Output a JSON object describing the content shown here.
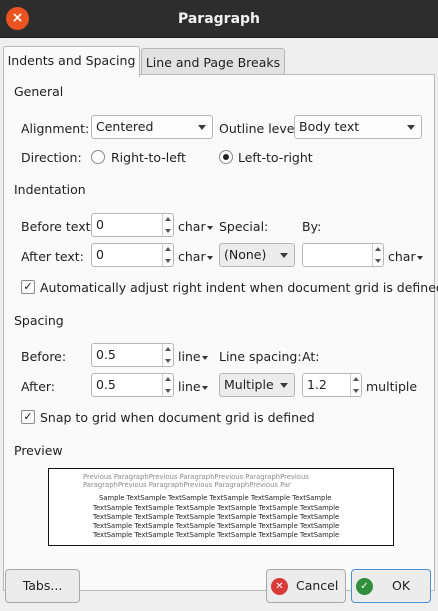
{
  "window": {
    "title": "Paragraph",
    "close_icon": "close-icon"
  },
  "tabs": [
    {
      "label": "Indents and Spacing",
      "active": true
    },
    {
      "label": "Line and Page Breaks",
      "active": false
    }
  ],
  "general": {
    "section_label": "General",
    "alignment_label": "Alignment:",
    "alignment_value": "Centered",
    "outline_label": "Outline level:",
    "outline_value": "Body text",
    "direction_label": "Direction:",
    "rtl_label": "Right-to-left",
    "ltr_label": "Left-to-right",
    "direction_selected": "ltr"
  },
  "indentation": {
    "section_label": "Indentation",
    "before_label": "Before text:",
    "before_value": "0",
    "before_unit": "char",
    "special_label": "Special:",
    "special_value": "(None)",
    "by_label": "By:",
    "by_value": "",
    "by_unit": "char",
    "after_label": "After text:",
    "after_value": "0",
    "after_unit": "char",
    "auto_adjust_label": "Automatically adjust right indent when document grid is defined",
    "auto_adjust_checked": true
  },
  "spacing": {
    "section_label": "Spacing",
    "before_label": "Before:",
    "before_value": "0.5",
    "before_unit": "line",
    "line_spacing_label": "Line spacing:",
    "line_spacing_value": "Multiple",
    "at_label": "At:",
    "at_value": "1.2",
    "at_unit": "multiple",
    "after_label": "After:",
    "after_value": "0.5",
    "after_unit": "line",
    "snap_label": "Snap to grid when document grid is defined",
    "snap_checked": true
  },
  "preview": {
    "section_label": "Preview",
    "prev_line1": "Previous ParagraphPrevious ParagraphPrevious ParagraphPrevious",
    "prev_line2": "ParagraphPrevious ParagraphPrevious ParagraphPrevious Par",
    "sample_line1": "Sample TextSample TextSample TextSample TextSample TextSample",
    "sample_line2": "TextSample TextSample TextSample TextSample TextSample TextSample",
    "sample_line3": "TextSample TextSample TextSample TextSample TextSample TextSample",
    "sample_line4": "TextSample TextSample TextSample TextSample TextSample TextSample",
    "sample_line5": "TextSample TextSample TextSample TextSample TextSample TextSample"
  },
  "buttons": {
    "tabs_label": "Tabs...",
    "cancel_label": "Cancel",
    "ok_label": "OK"
  }
}
